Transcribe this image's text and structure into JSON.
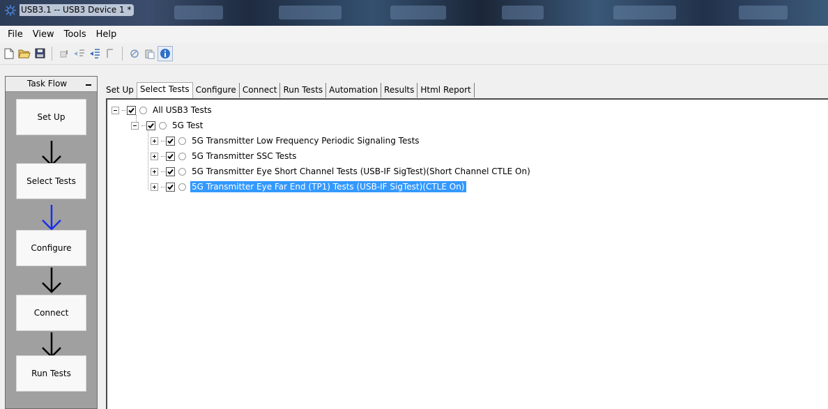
{
  "window": {
    "title": "USB3.1 -- USB3 Device 1 *"
  },
  "menu": {
    "items": [
      "File",
      "View",
      "Tools",
      "Help"
    ]
  },
  "toolbar": {
    "buttons": [
      "new-icon",
      "open-icon",
      "save-icon",
      "run-icon",
      "run-selected-icon",
      "step-icon",
      "stop-icon",
      "copy-icon",
      "paste-icon",
      "info-icon"
    ]
  },
  "taskflow": {
    "title": "Task Flow",
    "steps": [
      "Set Up",
      "Select Tests",
      "Configure",
      "Connect",
      "Run Tests"
    ],
    "active_step": "Select Tests"
  },
  "tabs": {
    "items": [
      "Set Up",
      "Select Tests",
      "Configure",
      "Connect",
      "Run Tests",
      "Automation",
      "Results",
      "Html Report"
    ],
    "selected": "Select Tests"
  },
  "tree": {
    "root": {
      "label": "All USB3 Tests",
      "checked": true
    },
    "group": {
      "label": "5G Test",
      "checked": true
    },
    "items": [
      {
        "label": "5G Transmitter Low Frequency Periodic Signaling Tests",
        "checked": true,
        "selected": false
      },
      {
        "label": "5G Transmitter SSC Tests",
        "checked": true,
        "selected": false
      },
      {
        "label": "5G Transmitter Eye Short Channel Tests (USB-IF SigTest)(Short Channel CTLE On)",
        "checked": true,
        "selected": false
      },
      {
        "label": "5G Transmitter Eye Far End (TP1) Tests (USB-IF SigTest)(CTLE On)",
        "checked": true,
        "selected": true
      }
    ]
  },
  "colors": {
    "selection": "#3399ff",
    "active_arrow": "#1a2fe8"
  }
}
